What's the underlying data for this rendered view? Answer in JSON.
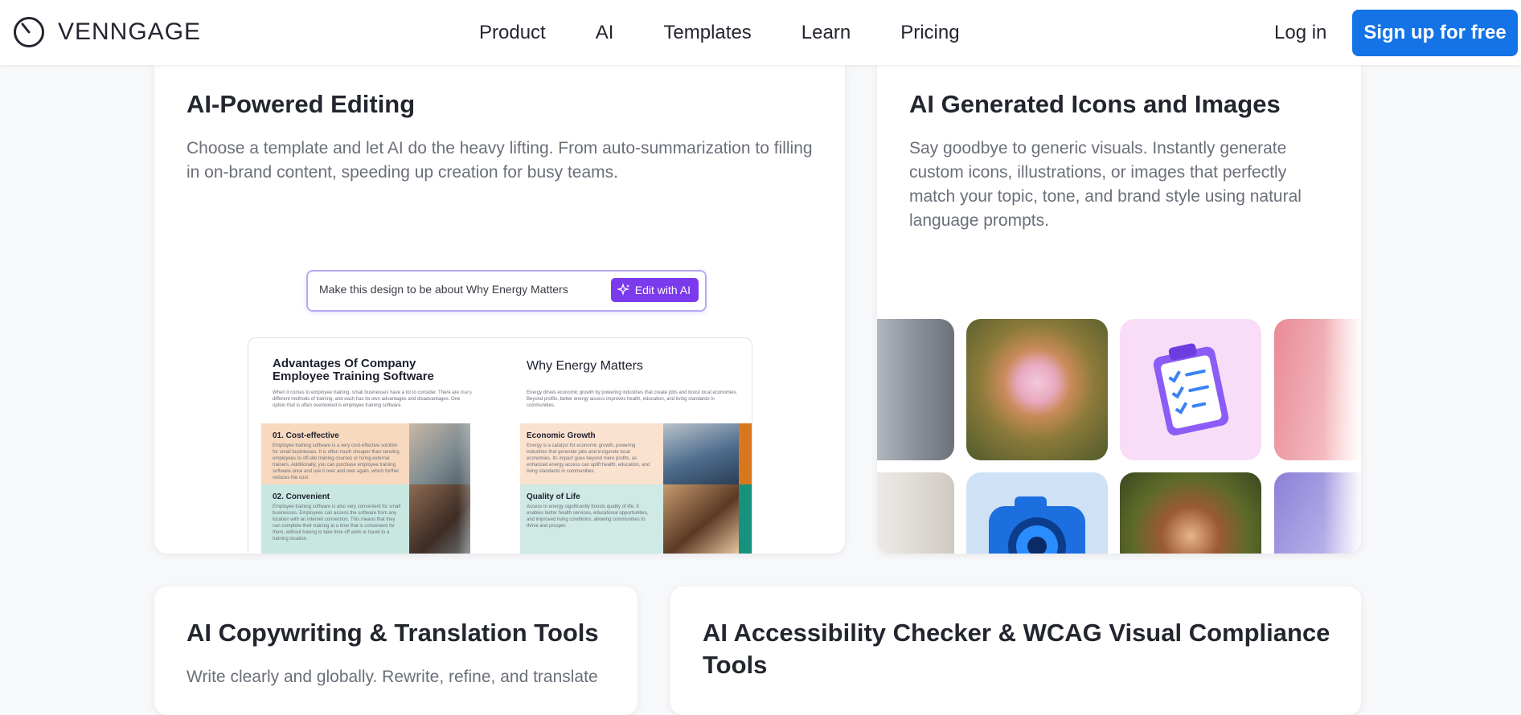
{
  "nav": {
    "logo": "VENNGAGE",
    "links": [
      "Product",
      "AI",
      "Templates",
      "Learn",
      "Pricing"
    ],
    "login": "Log in",
    "signup": "Sign up for free"
  },
  "cards": {
    "editing": {
      "title": "AI-Powered Editing",
      "desc": "Choose a template and let AI do the heavy lifting. From auto-summarization to filling in on-brand content, speeding up creation for busy teams.",
      "prompt": "Make this design to be about Why Energy Matters",
      "edit_btn": "Edit with AI",
      "doc_left": {
        "title": "Advantages Of Company Employee Training Software",
        "intro": "When it comes to employee training, small businesses have a lot to consider. There are many different methods of training, and each has its own advantages and disadvantages. One option that is often overlooked is employee training software.",
        "s1_title": "01. Cost-effective",
        "s1_text": "Employee training software is a very cost-effective solution for small businesses. It is often much cheaper than sending employees to off-site training courses or hiring external trainers. Additionally, you can purchase employee training software once and use it over and over again, which further reduces the cost.",
        "s2_title": "02. Convenient",
        "s2_text": "Employee training software is also very convenient for small businesses. Employees can access the software from any location with an internet connection. This means that they can complete their training at a time that is convenient for them, without having to take time off work or travel to a training location."
      },
      "doc_right": {
        "title": "Why Energy Matters",
        "intro": "Energy drives economic growth by powering industries that create jobs and boost local economies. Beyond profits, better energy access improves health, education, and living standards in communities.",
        "s1_title": "Economic Growth",
        "s1_text": "Energy is a catalyst for economic growth, powering industries that generate jobs and invigorate local economies. Its impact goes beyond mere profits, as enhanced energy access can uplift health, education, and living standards in communities.",
        "s2_title": "Quality of Life",
        "s2_text": "Access to energy significantly boosts quality of life. It enables better health services, educational opportunities, and improved living conditions, allowing communities to thrive and prosper."
      }
    },
    "icons": {
      "title": "AI Generated Icons and Images",
      "desc": "Say goodbye to generic visuals. Instantly generate custom icons, illustrations, or images that perfectly match your topic, tone, and brand style using natural language prompts."
    },
    "copywriting": {
      "title": "AI Copywriting & Translation Tools",
      "desc": "Write clearly and globally. Rewrite, refine, and translate"
    },
    "accessibility": {
      "title": "AI Accessibility Checker & WCAG Visual Compliance Tools"
    }
  },
  "colors": {
    "brand": "#1473e6",
    "ai_purple": "#7c3aed"
  }
}
